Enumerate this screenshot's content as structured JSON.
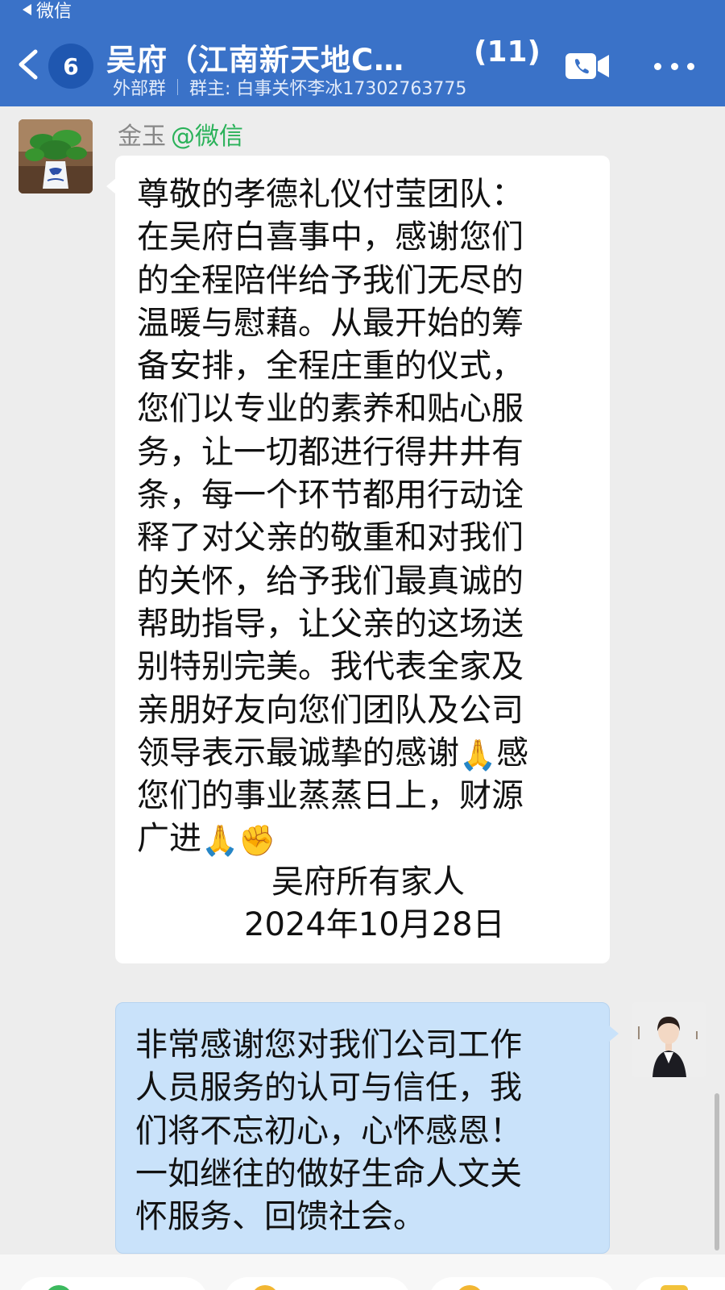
{
  "status_bar": {
    "back_app_label": "微信"
  },
  "header": {
    "unread_count": "6",
    "title": "吴府（江南新天地C…",
    "member_count": "(11)",
    "group_type": "外部群",
    "owner": "群主: 白事关怀李冰17302763775",
    "icons": [
      "back-chevron-icon",
      "phone-call-icon",
      "more-icon"
    ]
  },
  "messages": [
    {
      "side": "left",
      "sender": "金玉",
      "sender_tag": "@微信",
      "body": "尊敬的孝德礼仪付莹团队：\n在吴府白喜事中，感谢您们\n的全程陪伴给予我们无尽的\n温暖与慰藉。从最开始的筹\n备安排，全程庄重的仪式，\n您们以专业的素养和贴心服\n务，让一切都进行得井井有\n条，每一个环节都用行动诠\n释了对父亲的敬重和对我们\n的关怀，给予我们最真诚的\n帮助指导，让父亲的这场送\n别特别完美。我代表全家及\n亲朋好友向您们团队及公司\n领导表示最诚挚的感谢",
      "emoji_1": "🙏",
      "body_2": "感\n您们的事业蒸蒸日上，财源\n广进",
      "emoji_2": "🙏",
      "emoji_3": "✊",
      "signature": "吴府所有家人",
      "date": "2024年10月28日"
    },
    {
      "side": "right",
      "body": "非常感谢您对我们公司工作\n人员服务的认可与信任，我\n们将不忘初心，心怀感恩！\n一如继往的做好生命人文关\n怀服务、回馈社会。"
    }
  ],
  "colors": {
    "header_bg": "#3a72c8",
    "badge_bg": "#1f57b0",
    "chat_bg": "#ededed",
    "incoming_bubble": "#ffffff",
    "outgoing_bubble": "#c9e2fa",
    "wechat_tag": "#2bb25a"
  }
}
